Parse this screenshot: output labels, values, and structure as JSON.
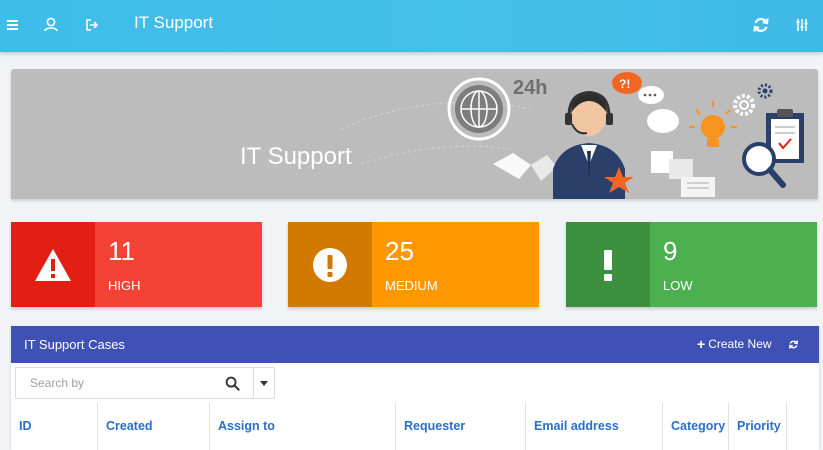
{
  "app": {
    "title": "IT Support",
    "icons": {
      "menu": "hamburger-icon",
      "user": "user-icon",
      "logout": "logout-icon",
      "refresh": "refresh-icon",
      "settings": "sliders-icon"
    }
  },
  "banner": {
    "title": "IT Support",
    "badge_text": "24h",
    "bubble_text": "?!"
  },
  "stats": [
    {
      "value": "11",
      "label": "HIGH",
      "icon": "warning-triangle-icon"
    },
    {
      "value": "25",
      "label": "MEDIUM",
      "icon": "exclamation-circle-icon"
    },
    {
      "value": "9",
      "label": "LOW",
      "icon": "exclamation-icon"
    }
  ],
  "cases": {
    "title": "IT Support Cases",
    "create_label": "Create New",
    "search_placeholder": "Search by",
    "columns": [
      "ID",
      "Created",
      "Assign to",
      "Requester",
      "Email address",
      "Category",
      "Priority"
    ]
  },
  "colors": {
    "topbar": "#3dbde9",
    "high": "#f44336",
    "medium": "#ff9800",
    "low": "#4caf50",
    "panel_header": "#3f51b5",
    "column_text": "#2a6fc9"
  }
}
